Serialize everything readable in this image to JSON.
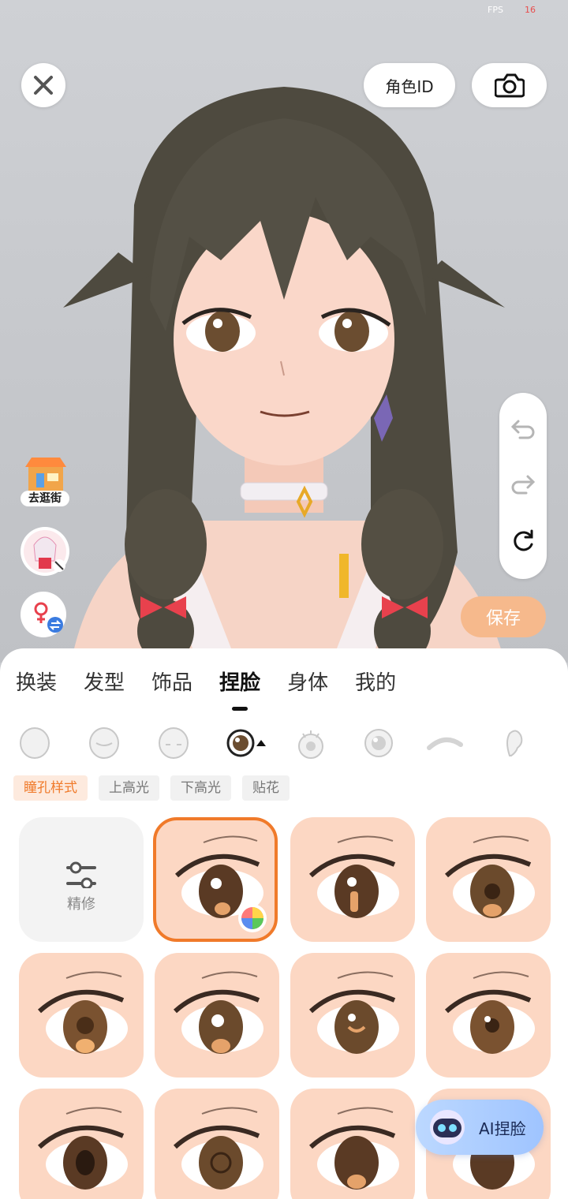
{
  "status": {
    "fps_label": "FPS",
    "fps_value": "16"
  },
  "header": {
    "role_id_label": "角色ID",
    "close_icon": "close-icon",
    "camera_icon": "camera-icon"
  },
  "history": {
    "undo_icon": "undo-icon",
    "redo_icon": "redo-icon",
    "reset_icon": "reset-icon"
  },
  "side": {
    "shop_label": "去逛街",
    "avatar_icon": "avatar-icon",
    "gender_icon": "gender-swap-icon"
  },
  "save_label": "保存",
  "tabs": [
    {
      "label": "换装"
    },
    {
      "label": "发型"
    },
    {
      "label": "饰品"
    },
    {
      "label": "捏脸",
      "active": true
    },
    {
      "label": "身体"
    },
    {
      "label": "我的"
    }
  ],
  "parts": [
    {
      "icon": "face-shape-icon"
    },
    {
      "icon": "face-icon"
    },
    {
      "icon": "face-features-icon"
    },
    {
      "icon": "eye-icon",
      "active": true
    },
    {
      "icon": "eye-lash-icon"
    },
    {
      "icon": "eye-highlight-icon"
    },
    {
      "icon": "eyebrow-icon"
    },
    {
      "icon": "ear-icon"
    }
  ],
  "subtabs": [
    {
      "label": "瞳孔样式",
      "active": true
    },
    {
      "label": "上高光"
    },
    {
      "label": "下高光"
    },
    {
      "label": "贴花"
    }
  ],
  "grid": {
    "refine_label": "精修",
    "refine_icon": "sliders-icon",
    "selected_index": 1,
    "color_wheel_icon": "color-wheel-icon"
  },
  "ai_label": "AI捏脸",
  "colors": {
    "accent": "#f07a2a",
    "save_bg": "#f6b98c",
    "cell_bg": "#fcd7c3"
  }
}
